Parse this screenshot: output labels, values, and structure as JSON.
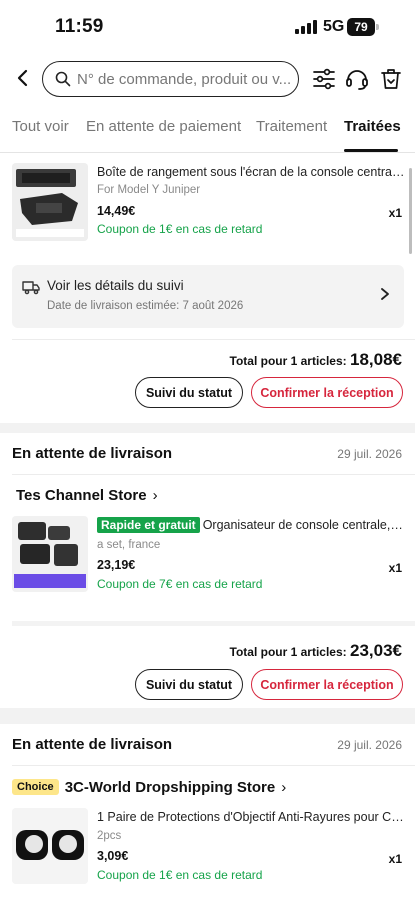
{
  "status_bar": {
    "time": "11:59",
    "network": "5G",
    "battery": "79"
  },
  "header": {
    "search_placeholder": "N° de commande, produit ou v..."
  },
  "tabs": [
    {
      "label": "Tout voir"
    },
    {
      "label": "En attente de paiement"
    },
    {
      "label": "Traitement"
    },
    {
      "label": "Traitées"
    }
  ],
  "order1": {
    "product": {
      "title": "Boîte de rangement sous l'écran de la console centrale po...",
      "variant": "For Model Y Juniper",
      "price": "14,49€",
      "coupon": "Coupon de 1€ en cas de retard",
      "qty": "x1"
    },
    "tracking": {
      "title": "Voir les détails du suivi",
      "date": "Date de livraison estimée: 7 août 2026"
    },
    "total_label": "Total pour 1 articles:",
    "total_amount": "18,08€",
    "btn_status": "Suivi du statut",
    "btn_confirm": "Confirmer la réception"
  },
  "order2": {
    "status": "En attente de livraison",
    "date": "29 juil. 2026",
    "store": "Tes Channel Store",
    "product": {
      "badge": "Rapide et gratuit",
      "title": "Organisateur de console centrale, boîte...",
      "variant": "a set, france",
      "price": "23,19€",
      "coupon": "Coupon de 7€ en cas de retard",
      "qty": "x1"
    },
    "total_label": "Total pour 1 articles:",
    "total_amount": "23,03€",
    "btn_status": "Suivi du statut",
    "btn_confirm": "Confirmer la réception"
  },
  "order3": {
    "status": "En attente de livraison",
    "date": "29 juil. 2026",
    "store_badge": "Choice",
    "store": "3C-World Dropshipping Store",
    "product": {
      "title": "1 Paire de Protections d'Objectif Anti-Rayures pour Camé...",
      "variant": "2pcs",
      "price": "3,09€",
      "coupon": "Coupon de 1€ en cas de retard",
      "qty": "x1"
    }
  },
  "colors": {
    "accent_red": "#d6263d",
    "coupon_green": "#16a34a",
    "choice_yellow": "#fde68a"
  },
  "icons": [
    "back-arrow-icon",
    "search-icon",
    "filter-icon",
    "support-headset-icon",
    "trash-icon",
    "truck-icon",
    "chevron-right-icon"
  ]
}
